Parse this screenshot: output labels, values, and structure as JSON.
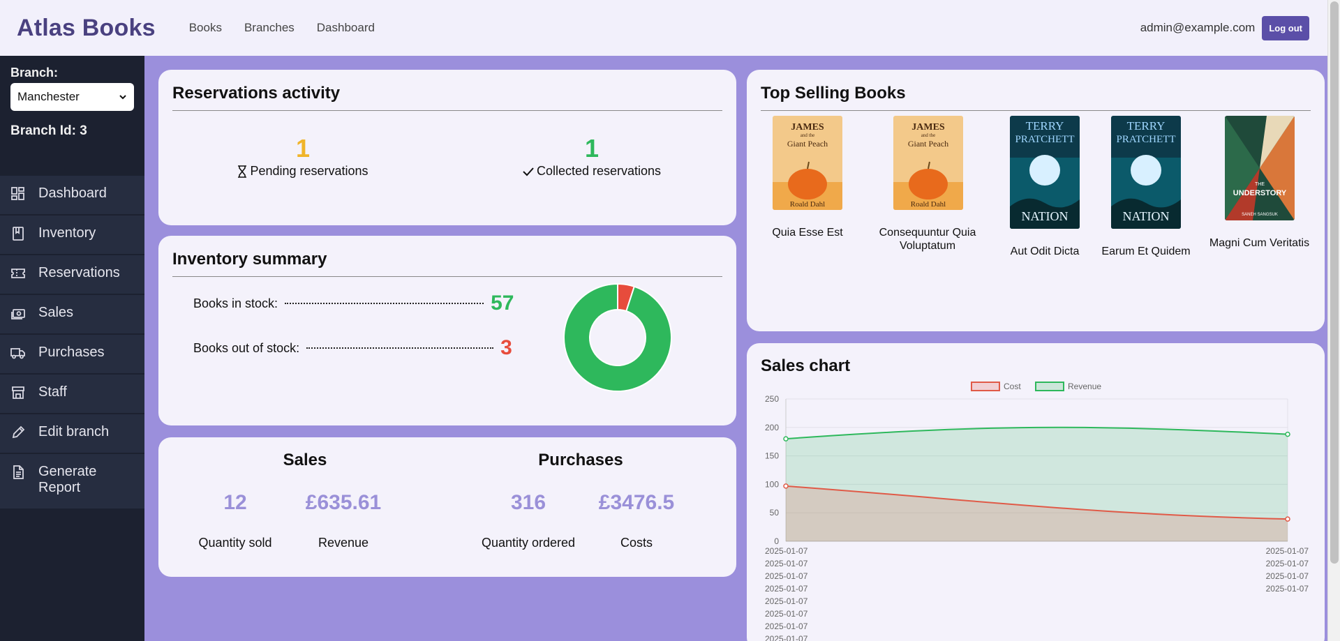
{
  "header": {
    "brand": "Atlas Books",
    "nav": [
      "Books",
      "Branches",
      "Dashboard"
    ],
    "user_email": "admin@example.com",
    "logout_label": "Log out"
  },
  "sidebar": {
    "branch_label": "Branch:",
    "branch_selected": "Manchester",
    "branch_id": "Branch Id: 3",
    "items": [
      {
        "label": "Dashboard",
        "icon": "dashboard-icon"
      },
      {
        "label": "Inventory",
        "icon": "book-icon"
      },
      {
        "label": "Reservations",
        "icon": "ticket-icon"
      },
      {
        "label": "Sales",
        "icon": "cash-icon"
      },
      {
        "label": "Purchases",
        "icon": "truck-icon"
      },
      {
        "label": "Staff",
        "icon": "store-icon"
      },
      {
        "label": "Edit branch",
        "icon": "pencil-icon"
      },
      {
        "label": "Generate Report",
        "icon": "document-icon"
      }
    ]
  },
  "reservations": {
    "title": "Reservations activity",
    "pending_count": "1",
    "pending_label": "Pending reservations",
    "collected_count": "1",
    "collected_label": "Collected reservations",
    "pending_color": "#f0b429",
    "collected_color": "#2eb85c"
  },
  "inventory": {
    "title": "Inventory summary",
    "in_stock_label": "Books in stock:",
    "in_stock_value": "57",
    "out_stock_label": "Books out of stock:",
    "out_stock_value": "3",
    "in_color": "#2eb85c",
    "out_color": "#e74c3c",
    "donut": {
      "in_stock": 57,
      "out_of_stock": 3
    }
  },
  "sales_purchases": {
    "sales_title": "Sales",
    "purchases_title": "Purchases",
    "quantity_sold": "12",
    "quantity_sold_label": "Quantity sold",
    "revenue": "£635.61",
    "revenue_label": "Revenue",
    "quantity_ordered": "316",
    "quantity_ordered_label": "Quantity ordered",
    "costs": "£3476.5",
    "costs_label": "Costs"
  },
  "top_books": {
    "title": "Top Selling Books",
    "books": [
      {
        "title": "Quia Esse Est",
        "cover_line1": "JAMES",
        "cover_line2": "and the",
        "cover_line3": "Giant Peach",
        "cover_author": "Roald Dahl"
      },
      {
        "title": "Consequuntur Quia Voluptatum",
        "cover_line1": "JAMES",
        "cover_line2": "and the",
        "cover_line3": "Giant Peach",
        "cover_author": "Roald Dahl"
      },
      {
        "title": "Aut Odit Dicta",
        "cover_line1": "TERRY",
        "cover_line2": "PRATCHETT",
        "cover_line3": "NATION",
        "cover_author": ""
      },
      {
        "title": "Earum Et Quidem",
        "cover_line1": "TERRY",
        "cover_line2": "PRATCHETT",
        "cover_line3": "NATION",
        "cover_author": ""
      },
      {
        "title": "Magni Cum Veritatis",
        "cover_line1": "THE",
        "cover_line2": "UNDERSTORY",
        "cover_line3": "",
        "cover_author": "SANEH SANGSUK"
      }
    ]
  },
  "sales_chart": {
    "title": "Sales chart"
  },
  "chart_data": {
    "type": "line",
    "title": "Sales chart",
    "x_tick_label": "2025-01-07",
    "x_label_rows_left": 8,
    "x_label_rows_right": 4,
    "series": [
      {
        "name": "Cost",
        "x": [
          "2025-01-07",
          "2025-01-07"
        ],
        "values": [
          97,
          39
        ],
        "color": "#e05a47"
      },
      {
        "name": "Revenue",
        "x": [
          "2025-01-07",
          "2025-01-07"
        ],
        "values": [
          180,
          188
        ],
        "color": "#2eb85c"
      }
    ],
    "ylim": [
      0,
      250
    ],
    "yticks": [
      0,
      50,
      100,
      150,
      200,
      250
    ],
    "fill": true,
    "legend": "top",
    "grid": true
  }
}
